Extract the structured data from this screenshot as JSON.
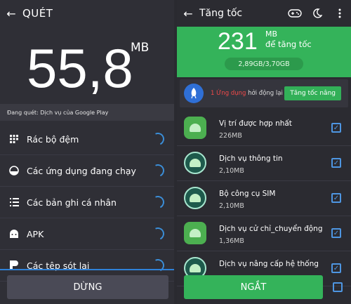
{
  "left": {
    "title": "QUÉT",
    "size_value": "55,8",
    "size_unit": "MB",
    "scan_status": "Đang quét: Dịch vụ của Google Play",
    "items": [
      {
        "label": "Rác bộ đệm",
        "icon": "grid-icon"
      },
      {
        "label": "Các ứng dụng đang chạy",
        "icon": "running-apps-icon"
      },
      {
        "label": "Các bản ghi cá nhân",
        "icon": "list-icon"
      },
      {
        "label": "APK",
        "icon": "android-icon"
      },
      {
        "label": "Các tệp sót lại",
        "icon": "leftover-files-icon"
      }
    ],
    "stop_label": "DỪNG"
  },
  "right": {
    "title": "Tăng tốc",
    "free_value": "231",
    "free_unit": "MB",
    "free_caption": "để tăng tốc",
    "ram_usage": "2,89GB/3,70GB",
    "boost": {
      "count": "1 Ứng dụng",
      "text": "hởi động lại",
      "button": "Tăng tốc nâng"
    },
    "apps": [
      {
        "name": "Vị trí được hợp nhất",
        "size": "226MB"
      },
      {
        "name": "Dịch vụ thông tin",
        "size": "2,10MB"
      },
      {
        "name": "Bộ công cụ SIM",
        "size": "2,10MB"
      },
      {
        "name": "Dịch vụ cử chỉ_chuyển động",
        "size": "1,36MB"
      },
      {
        "name": "Dịch vụ nâng cấp hệ thống",
        "size": ""
      }
    ],
    "stop_label": "NGẮT"
  },
  "colors": {
    "accent_green": "#34b35a",
    "accent_blue": "#3b8ed8",
    "bg": "#2f2f36"
  }
}
